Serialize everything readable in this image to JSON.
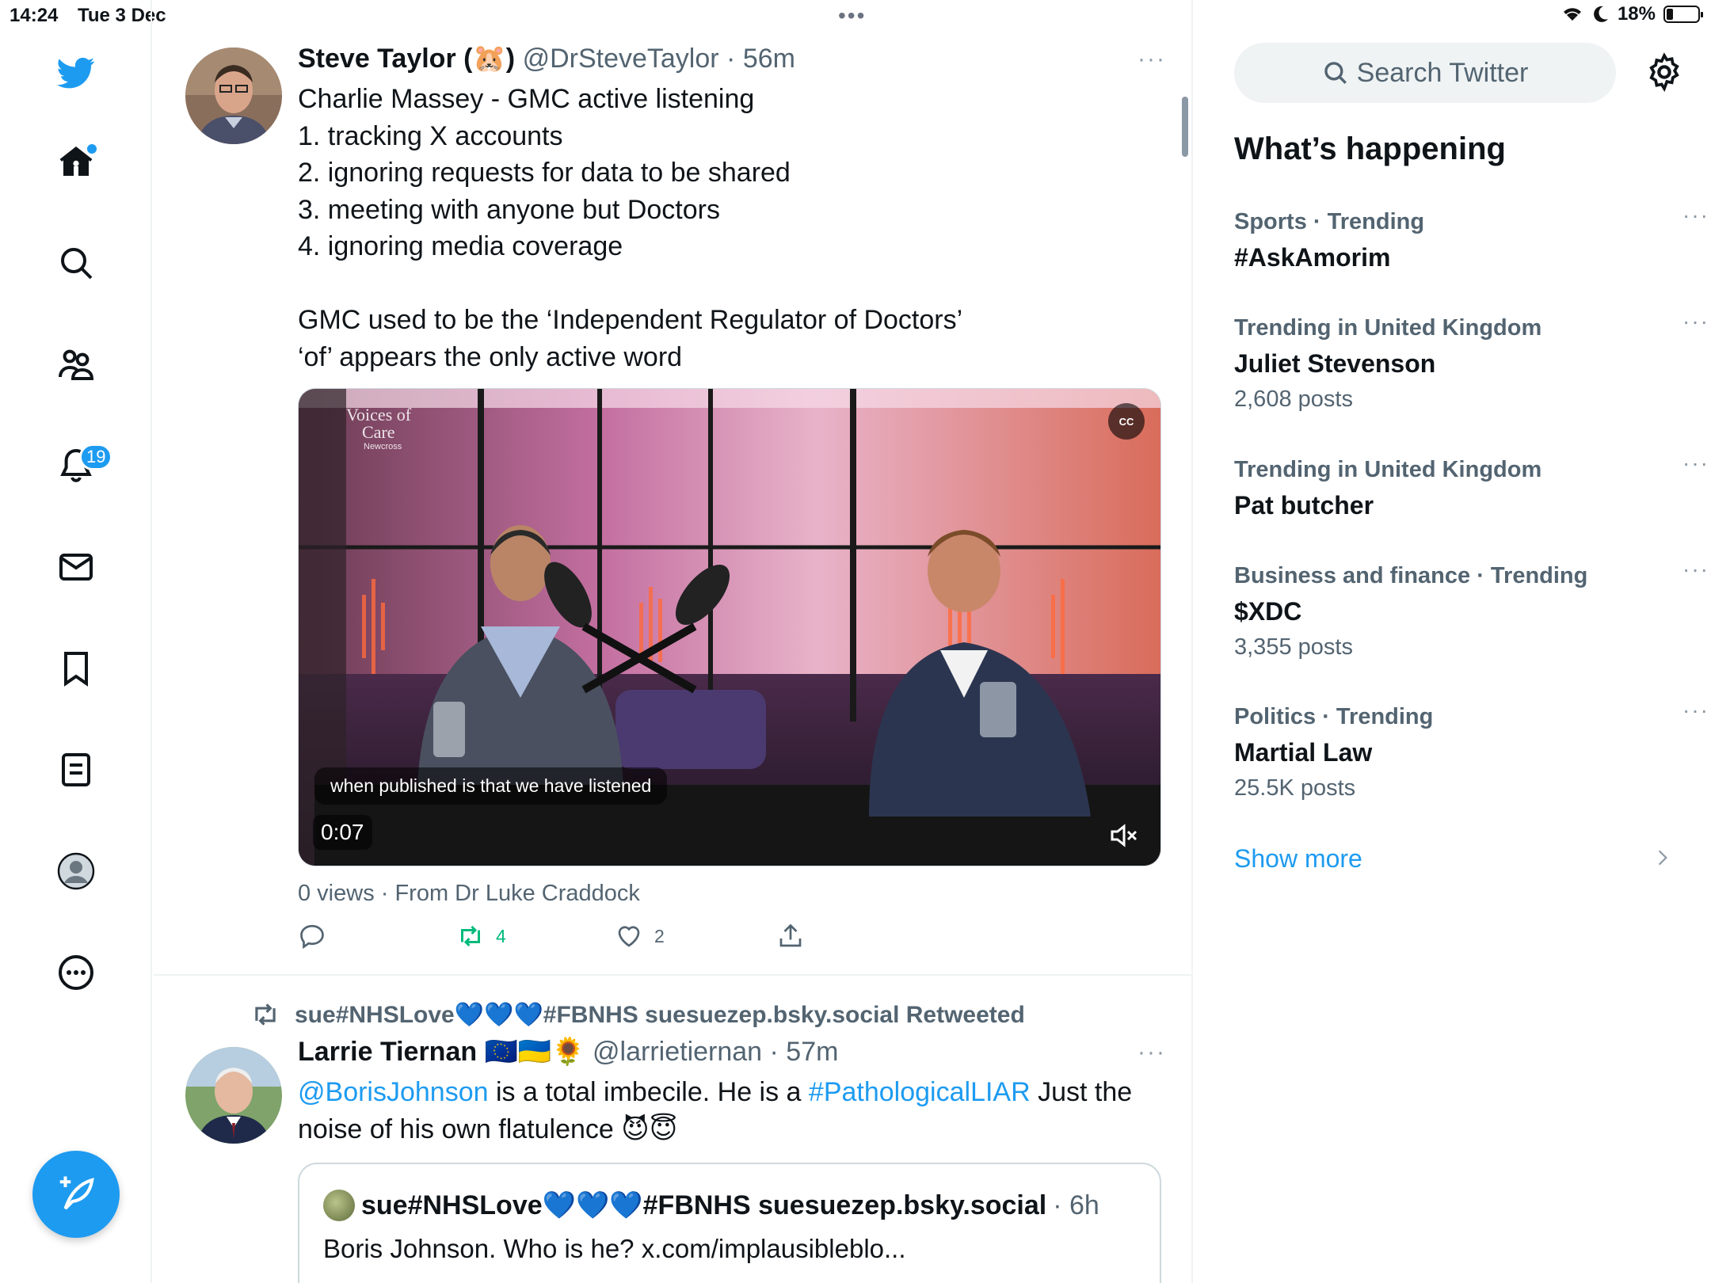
{
  "status_bar": {
    "time": "14:24",
    "date": "Tue 3 Dec",
    "battery": "18%"
  },
  "nav": {
    "notifications_badge": "19"
  },
  "tweet1": {
    "name": "Steve Taylor (🐹)",
    "handle": "@DrSteveTaylor",
    "time": "· 56m",
    "more": "···",
    "text": "Charlie Massey - GMC active listening\n1. tracking X accounts\n2. ignoring requests for data to be shared\n3. meeting with anyone but Doctors\n4. ignoring media coverage\n\nGMC used to be the ‘Independent Regulator of Doctors’\n‘of’ appears the only active word",
    "video": {
      "caption": "when published is that we have listened",
      "duration": "0:07",
      "cc": "CC",
      "watermark": "Voices of Care · Newcross"
    },
    "stats": "0 views · From Dr Luke Craddock",
    "retweets": "4",
    "likes": "2"
  },
  "tweet2": {
    "retweeted_by": "sue#NHSLove💙💙💙#FBNHS suesuezep.bsky.social Retweeted",
    "name": "Larrie Tiernan 🇪🇺🇺🇦🌻",
    "handle": "@larrietiernan",
    "time": "· 57m",
    "more": "···",
    "mention": "@BorisJohnson",
    "text_a": " is a total imbecile. He is a ",
    "hashtag": "#PathologicalLIAR",
    "text_b": " Just the noise of his own flatulence 😈😇",
    "quote": {
      "name": "sue#NHSLove💙💙💙#FBNHS suesuezep.bsky.social",
      "time": "· 6h",
      "text": "Boris Johnson. Who is he? x.com/implausibleblo..."
    }
  },
  "sidebar": {
    "search_placeholder": "Search Twitter",
    "title": "What’s happening",
    "trends": [
      {
        "context": "Sports · Trending",
        "topic": "#AskAmorim",
        "posts": ""
      },
      {
        "context": "Trending in United Kingdom",
        "topic": "Juliet Stevenson",
        "posts": "2,608 posts"
      },
      {
        "context": "Trending in United Kingdom",
        "topic": "Pat butcher",
        "posts": ""
      },
      {
        "context": "Business and finance · Trending",
        "topic": "$XDC",
        "posts": "3,355 posts"
      },
      {
        "context": "Politics · Trending",
        "topic": "Martial Law",
        "posts": "25.5K posts"
      }
    ],
    "more": "···",
    "show_more": "Show more"
  },
  "colors": {
    "accent": "#1d9bf0",
    "retweet_green": "#00ba7c",
    "muted": "#536471"
  }
}
